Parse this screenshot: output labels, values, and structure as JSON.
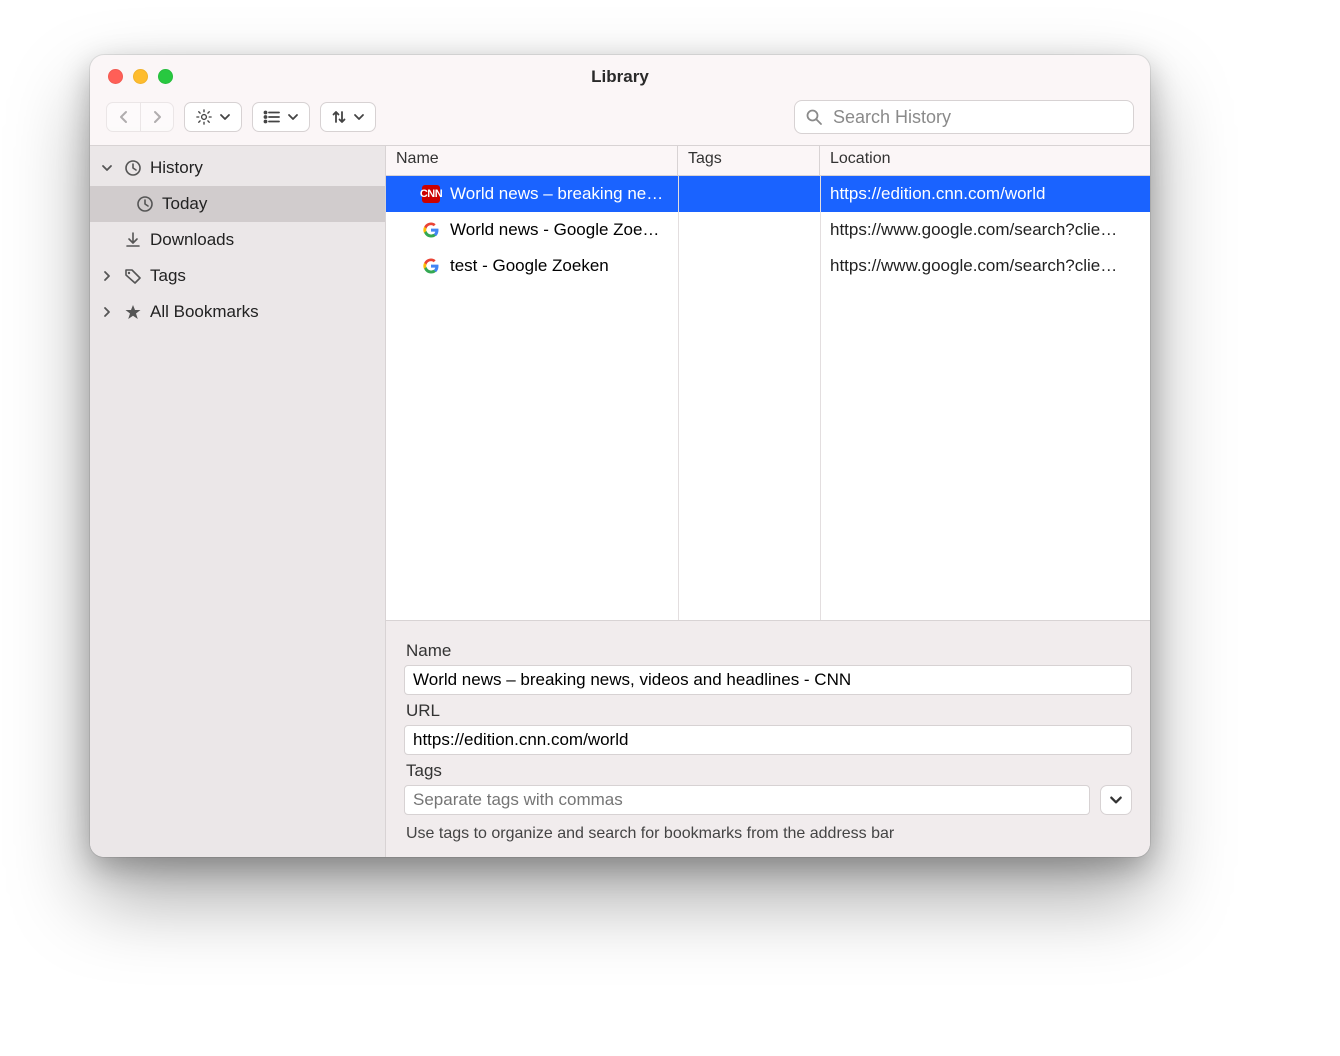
{
  "window": {
    "title": "Library"
  },
  "toolbar": {
    "search_placeholder": "Search History"
  },
  "sidebar": {
    "history": "History",
    "today": "Today",
    "downloads": "Downloads",
    "tags": "Tags",
    "all_bookmarks": "All Bookmarks"
  },
  "columns": {
    "name": "Name",
    "tags": "Tags",
    "location": "Location"
  },
  "rows": [
    {
      "name": "World news – breaking ne…",
      "tags": "",
      "location": "https://edition.cnn.com/world",
      "icon": "cnn",
      "selected": true
    },
    {
      "name": "World news - Google Zoe…",
      "tags": "",
      "location": "https://www.google.com/search?clie…",
      "icon": "google",
      "selected": false
    },
    {
      "name": "test - Google Zoeken",
      "tags": "",
      "location": "https://www.google.com/search?clie…",
      "icon": "google",
      "selected": false
    }
  ],
  "details": {
    "name_label": "Name",
    "name_value": "World news – breaking news, videos and headlines - CNN",
    "url_label": "URL",
    "url_value": "https://edition.cnn.com/world",
    "tags_label": "Tags",
    "tags_placeholder": "Separate tags with commas",
    "hint": "Use tags to organize and search for bookmarks from the address bar"
  }
}
